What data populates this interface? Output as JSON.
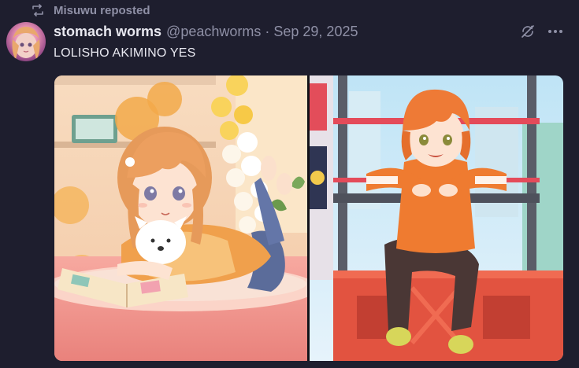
{
  "repost": {
    "label": "Misuwu reposted",
    "icon": "repost-icon"
  },
  "author": {
    "name": "stomach worms",
    "handle": "@peachworms",
    "separator": "·",
    "date": "Sep 29, 2025",
    "avatar_icon": "avatar"
  },
  "post": {
    "text": "LOLISHO AKIMINO YES"
  },
  "actions": {
    "mute_icon": "mute-thread-icon",
    "more_icon": "more-options-icon"
  },
  "media": {
    "left_image": "illustration-girl-lying-with-dog",
    "right_image": "illustration-boy-sitting-on-scaffold"
  },
  "colors": {
    "background": "#1e1e2e",
    "text": "#e8e8f0",
    "muted": "#8f90a6"
  }
}
